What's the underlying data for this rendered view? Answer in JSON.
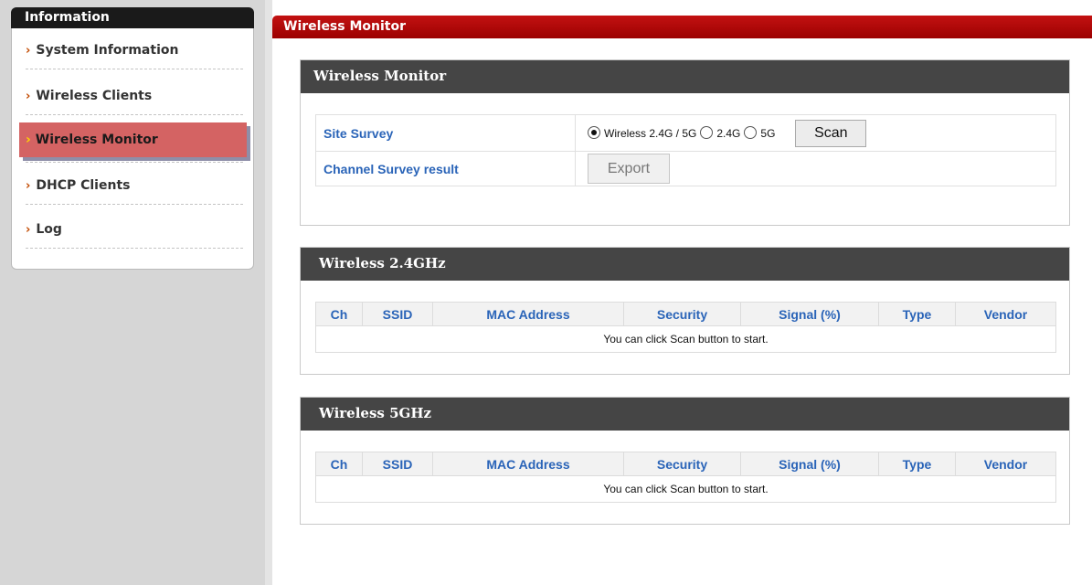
{
  "sidebar": {
    "header": "Information",
    "items": [
      {
        "label": "System Information"
      },
      {
        "label": "Wireless Clients"
      },
      {
        "label": "Wireless Monitor"
      },
      {
        "label": "DHCP Clients"
      },
      {
        "label": "Log"
      }
    ],
    "active_index": 2,
    "chevron": "›"
  },
  "page_title": "Wireless Monitor",
  "monitor_box": {
    "title": "Wireless Monitor",
    "site_survey_label": "Site Survey",
    "radio_options": [
      "Wireless 2.4G / 5G",
      "2.4G",
      "5G"
    ],
    "selected_option": "Wireless 2.4G / 5G",
    "scan_button": "Scan",
    "channel_label": "Channel Survey result",
    "export_button": "Export"
  },
  "wireless_24": {
    "title": "Wireless 2.4GHz",
    "columns": [
      "Ch",
      "SSID",
      "MAC Address",
      "Security",
      "Signal (%)",
      "Type",
      "Vendor"
    ],
    "empty_message": "You can click Scan button to start."
  },
  "wireless_5": {
    "title": "Wireless 5GHz",
    "columns": [
      "Ch",
      "SSID",
      "MAC Address",
      "Security",
      "Signal (%)",
      "Type",
      "Vendor"
    ],
    "empty_message": "You can click Scan button to start."
  },
  "colors": {
    "title_bar": "#b30000",
    "box_header": "#454545",
    "label_blue": "#2a64b8",
    "active_item": "#d46363"
  }
}
